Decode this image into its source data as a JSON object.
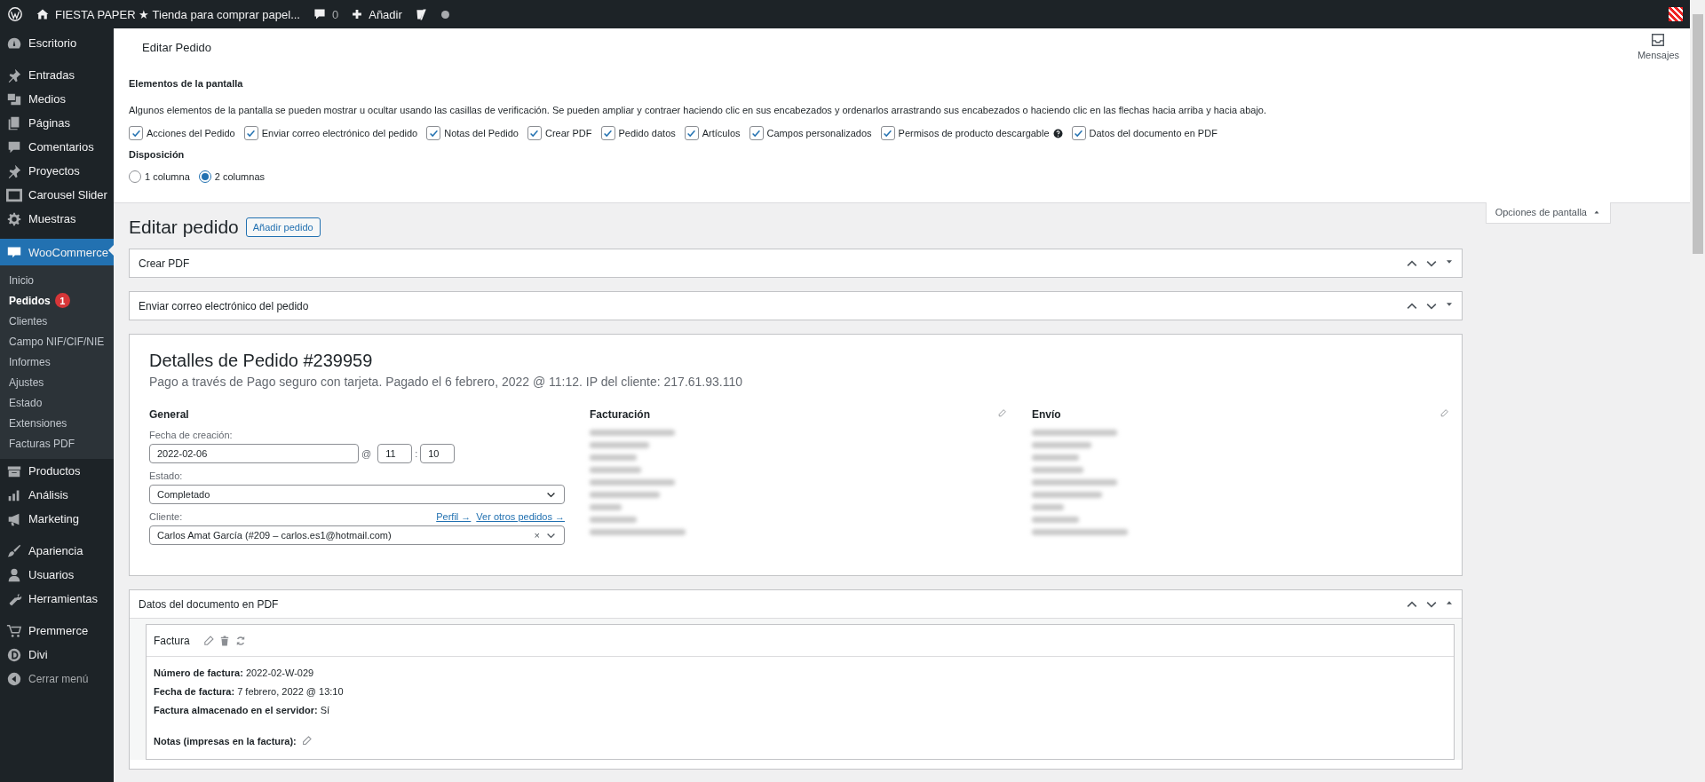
{
  "admin_bar": {
    "site_title": "FIESTA PAPER ★ Tienda para comprar papel...",
    "comments_count": "0",
    "new_label": "Añadir"
  },
  "sidebar": {
    "sections": [
      {
        "items": [
          {
            "label": "Escritorio",
            "selected": false
          }
        ]
      },
      {
        "items": [
          {
            "label": "Entradas",
            "selected": false
          },
          {
            "label": "Medios",
            "selected": false
          },
          {
            "label": "Páginas",
            "selected": false
          },
          {
            "label": "Comentarios",
            "selected": false
          },
          {
            "label": "Proyectos",
            "selected": false
          },
          {
            "label": "Carousel Slider",
            "selected": false
          },
          {
            "label": "Muestras",
            "selected": false
          }
        ]
      },
      {
        "items": [
          {
            "label": "WooCommerce",
            "selected": true,
            "children": [
              {
                "label": "Inicio",
                "selected": false
              },
              {
                "label": "Pedidos",
                "selected": true,
                "badge": "1"
              },
              {
                "label": "Clientes",
                "selected": false
              },
              {
                "label": "Campo NIF/CIF/NIE",
                "selected": false
              },
              {
                "label": "Informes",
                "selected": false
              },
              {
                "label": "Ajustes",
                "selected": false
              },
              {
                "label": "Estado",
                "selected": false
              },
              {
                "label": "Extensiones",
                "selected": false
              },
              {
                "label": "Facturas PDF",
                "selected": false
              }
            ]
          },
          {
            "label": "Productos",
            "selected": false
          },
          {
            "label": "Análisis",
            "selected": false
          },
          {
            "label": "Marketing",
            "selected": false
          }
        ]
      },
      {
        "items": [
          {
            "label": "Apariencia",
            "selected": false
          },
          {
            "label": "Usuarios",
            "selected": false
          },
          {
            "label": "Herramientas",
            "selected": false
          }
        ]
      },
      {
        "items": [
          {
            "label": "Premmerce",
            "selected": false
          },
          {
            "label": "Divi",
            "selected": false
          },
          {
            "label": "Cerrar menú",
            "selected": false
          }
        ]
      }
    ]
  },
  "header": {
    "title": "Editar Pedido",
    "messages_label": "Mensajes"
  },
  "screen_options": {
    "expanded": true,
    "heading": "Elementos de la pantalla",
    "description": "Algunos elementos de la pantalla se pueden mostrar u ocultar usando las casillas de verificación. Se pueden ampliar y contraer haciendo clic en sus encabezados y ordenarlos arrastrando sus encabezados o haciendo clic en las flechas hacia arriba y hacia abajo.",
    "boxes": [
      {
        "label": "Acciones del Pedido",
        "checked": true,
        "help": false
      },
      {
        "label": "Enviar correo electrónico del pedido",
        "checked": true,
        "help": false
      },
      {
        "label": "Notas del Pedido",
        "checked": true,
        "help": false
      },
      {
        "label": "Crear PDF",
        "checked": true,
        "help": false
      },
      {
        "label": "Pedido datos",
        "checked": true,
        "help": false
      },
      {
        "label": "Artículos",
        "checked": true,
        "help": false
      },
      {
        "label": "Campos personalizados",
        "checked": true,
        "help": false
      },
      {
        "label": "Permisos de producto descargable",
        "checked": true,
        "help": true
      },
      {
        "label": "Datos del documento en PDF",
        "checked": true,
        "help": false
      }
    ],
    "layout_heading": "Disposición",
    "layout_options": [
      {
        "label": "1 columna",
        "selected": false
      },
      {
        "label": "2 columnas",
        "selected": true
      }
    ],
    "tab_label": "Opciones de pantalla"
  },
  "page_title": "Editar pedido",
  "add_button": "Añadir pedido",
  "postboxes_top": [
    {
      "title": "Crear PDF",
      "expanded": false
    },
    {
      "title": "Enviar correo electrónico del pedido",
      "expanded": false
    }
  ],
  "order": {
    "title": "Detalles de Pedido #239959",
    "subtitle": "Pago a través de Pago seguro con tarjeta. Pagado el 6 febrero, 2022 @ 11:12. IP del cliente: 217.61.93.110",
    "general": {
      "heading": "General",
      "date_label": "Fecha de creación:",
      "date": "2022-02-06",
      "at": "@",
      "hour": "11",
      "colon": ":",
      "minute": "10",
      "status_label": "Estado:",
      "status": "Completado",
      "customer_label": "Cliente:",
      "profile_link": "Perfil →",
      "orders_link": "Ver otros pedidos →",
      "customer": "Carlos Amat García (#209 – carlos.es1@hotmail.com)",
      "clear": "×"
    },
    "billing_heading": "Facturación",
    "shipping_heading": "Envío"
  },
  "pdf_box": {
    "title": "Datos del documento en PDF",
    "expanded": true,
    "document": {
      "title": "Factura",
      "lines": [
        "**Número de factura:** 2022-02-W-029",
        "**Fecha de factura:** 7 febrero, 2022 @ 13:10",
        "**Factura almacenado en el servidor:** Sí"
      ],
      "notes_label": "Notas (impresas en la factura):"
    }
  }
}
